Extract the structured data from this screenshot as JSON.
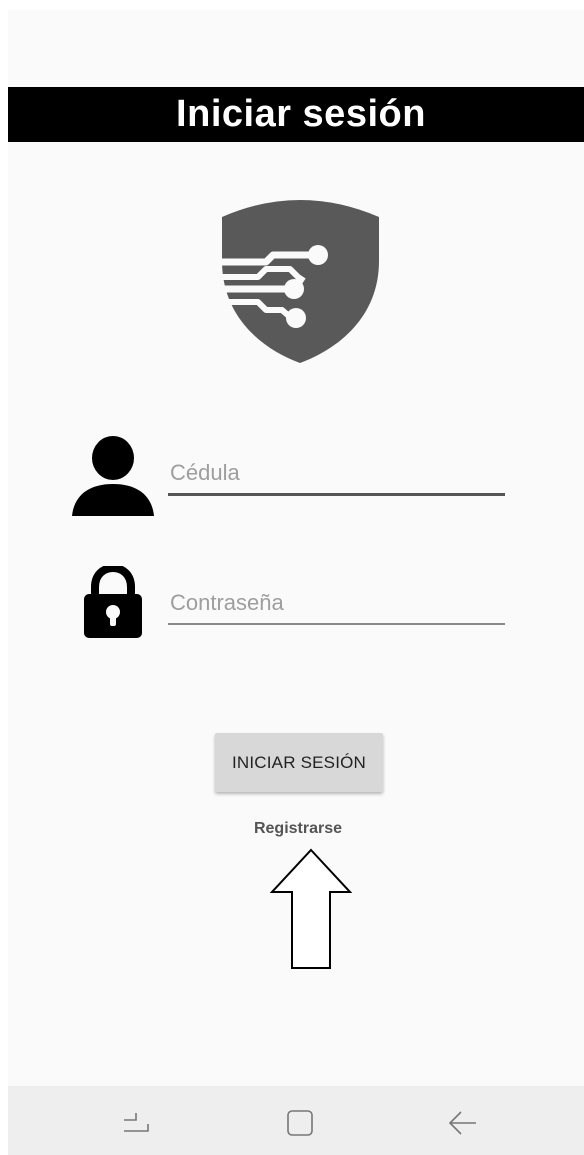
{
  "header": {
    "title": "Iniciar sesión"
  },
  "logo": {
    "icon": "shield-circuit-logo",
    "color": "#595959"
  },
  "form": {
    "user_field": {
      "icon": "user-icon",
      "placeholder": "Cédula",
      "value": ""
    },
    "password_field": {
      "icon": "lock-icon",
      "placeholder": "Contraseña",
      "value": ""
    },
    "login_button_label": "INICIAR SESIÓN",
    "register_link_label": "Registrarse"
  },
  "annotation": {
    "icon": "up-arrow-outline"
  },
  "nav_bar": {
    "buttons": [
      {
        "icon": "recents-icon"
      },
      {
        "icon": "home-icon"
      },
      {
        "icon": "back-icon"
      }
    ]
  },
  "colors": {
    "title_bar": "#000000",
    "background": "#fafafa",
    "button": "#d8d8d8",
    "nav_bar": "#eeeeee"
  }
}
